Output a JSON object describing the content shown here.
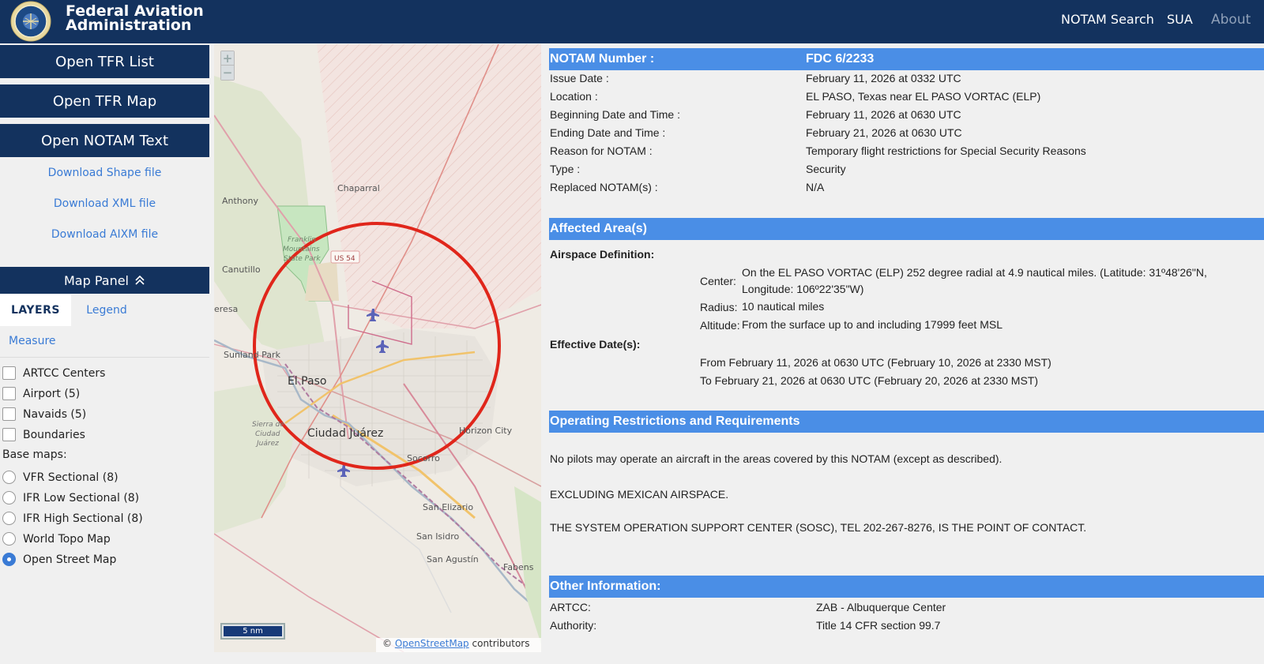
{
  "header": {
    "brand_line1": "Federal Aviation",
    "brand_line2": "Administration",
    "nav": {
      "notam_search": "NOTAM Search",
      "sua": "SUA",
      "about": "About"
    }
  },
  "sidebar": {
    "open_tfr_list": "Open TFR List",
    "open_tfr_map": "Open TFR Map",
    "open_notam_text": "Open NOTAM Text",
    "download_shape": "Download Shape file",
    "download_xml": "Download XML file",
    "download_aixm": "Download AIXM file",
    "map_panel": "Map Panel",
    "tabs": {
      "layers": "LAYERS",
      "legend": "Legend",
      "measure": "Measure"
    },
    "layers": [
      {
        "label": "ARTCC Centers",
        "checked": false
      },
      {
        "label": "Airport (5)",
        "checked": false
      },
      {
        "label": "Navaids (5)",
        "checked": false
      },
      {
        "label": "Boundaries",
        "checked": false
      }
    ],
    "basemaps_label": "Base maps:",
    "basemaps": [
      {
        "label": "VFR Sectional (8)",
        "selected": false
      },
      {
        "label": "IFR Low Sectional (8)",
        "selected": false
      },
      {
        "label": "IFR High Sectional (8)",
        "selected": false
      },
      {
        "label": "World Topo Map",
        "selected": false
      },
      {
        "label": "Open Street Map",
        "selected": true
      }
    ]
  },
  "map": {
    "zoom_in": "+",
    "zoom_out": "−",
    "scale": "5 nm",
    "attribution_prefix": "©",
    "attribution_link": "OpenStreetMap",
    "attribution_suffix": "contributors",
    "places": {
      "chaparral": "Chaparral",
      "anthony": "Anthony",
      "franklin1": "Franklin",
      "franklin2": "Mountains",
      "franklin3": "State Park",
      "us54": "US 54",
      "canutillo": "Canutillo",
      "teresa": "eresa",
      "sunland": "Sunland Park",
      "el_paso": "El Paso",
      "sierra1": "Sierra de",
      "sierra2": "Ciudad",
      "sierra3": "Juárez",
      "juarez": "Ciudad Juárez",
      "horizon": "Horizon City",
      "socorro": "Socorro",
      "san_elizario": "San Elizario",
      "san_isidro": "San Isidro",
      "san_agustin": "San Agustín",
      "fabens": "Fabens"
    },
    "colors": {
      "tfr_circle": "#e0261b",
      "restricted_hatch": "#e8a9a4",
      "park": "#c7e6c0"
    }
  },
  "notam": {
    "number_label": "NOTAM Number :",
    "number_value": "FDC 6/2233",
    "rows": [
      {
        "label": "Issue Date :",
        "value": "February 11, 2026 at 0332 UTC"
      },
      {
        "label": "Location :",
        "value": "EL PASO, Texas near EL PASO VORTAC (ELP)"
      },
      {
        "label": "Beginning Date and Time :",
        "value": "February 11, 2026 at 0630 UTC"
      },
      {
        "label": "Ending Date and Time :",
        "value": "February 21, 2026 at 0630 UTC"
      },
      {
        "label": "Reason for NOTAM :",
        "value": "Temporary flight restrictions for Special Security Reasons"
      },
      {
        "label": "Type :",
        "value": "Security"
      },
      {
        "label": "Replaced NOTAM(s) :",
        "value": "N/A"
      }
    ],
    "affected_title": "Affected Area(s)",
    "airspace_def": "Airspace Definition:",
    "center_label": "Center:",
    "center_value1": "On the EL PASO VORTAC (ELP) 252 degree radial at 4.9 nautical miles. (Latitude: 31º48'26\"N,",
    "center_value2": "Longitude: 106º22'35\"W)",
    "radius_label": "Radius:",
    "radius_value": "10 nautical miles",
    "altitude_label": "Altitude:",
    "altitude_value": "From the surface up to and including 17999 feet MSL",
    "effective_label": "Effective Date(s):",
    "effective_from": "From February 11, 2026 at 0630 UTC (February 10, 2026 at 2330 MST)",
    "effective_to": "To February 21, 2026 at 0630 UTC (February 20, 2026 at 2330 MST)",
    "ops_title": "Operating Restrictions and Requirements",
    "ops_p1": "No pilots may operate an aircraft in the areas covered by this NOTAM (except as described).",
    "ops_p2": "EXCLUDING MEXICAN AIRSPACE.",
    "ops_p3": "THE SYSTEM OPERATION SUPPORT CENTER (SOSC), TEL 202-267-8276, IS THE POINT OF CONTACT.",
    "other_title": "Other Information:",
    "artcc_label": "ARTCC:",
    "artcc_value": "ZAB - Albuquerque Center",
    "authority_label": "Authority:",
    "authority_value": "Title 14 CFR section 99.7"
  }
}
